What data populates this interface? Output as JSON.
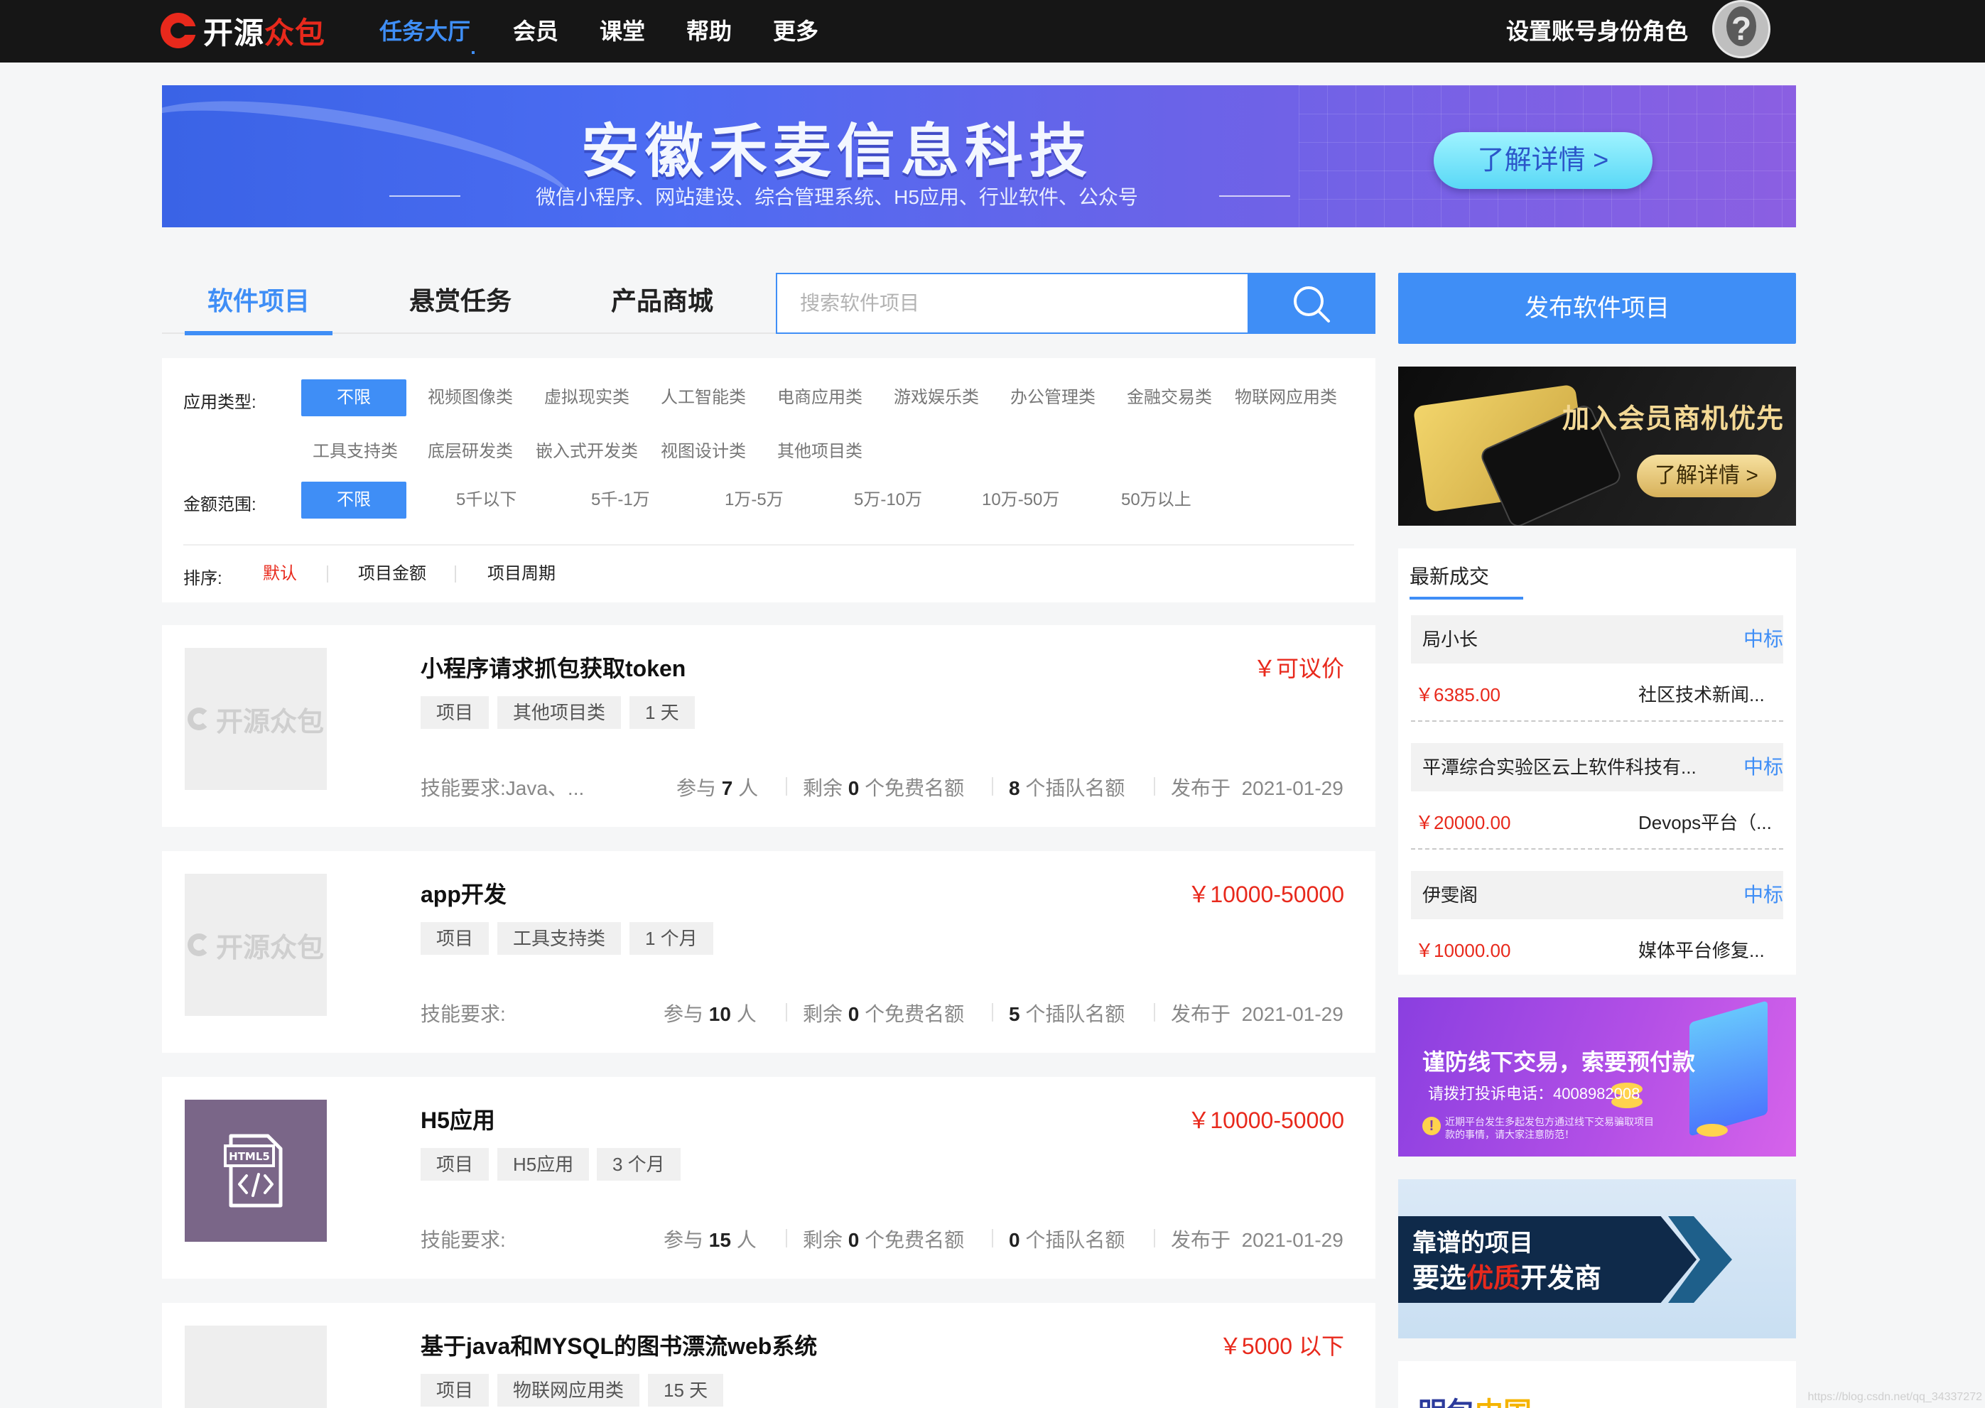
{
  "nav": {
    "logo_text_a": "开源",
    "logo_text_b": "众包",
    "items": [
      "任务大厅",
      "会员",
      "课堂",
      "帮助",
      "更多"
    ],
    "account_link": "设置账号身份角色",
    "avatar_glyph": "?"
  },
  "banner": {
    "title": "安徽禾麦信息科技",
    "subtitle": "微信小程序、网站建设、综合管理系统、H5应用、行业软件、公众号",
    "button": "了解详情 >"
  },
  "tabs": [
    "软件项目",
    "悬赏任务",
    "产品商城"
  ],
  "search": {
    "placeholder": "搜索软件项目"
  },
  "filters": {
    "type_label": "应用类型:",
    "type_options": [
      "不限",
      "视频图像类",
      "虚拟现实类",
      "人工智能类",
      "电商应用类",
      "游戏娱乐类",
      "办公管理类",
      "金融交易类",
      "物联网应用类",
      "工具支持类",
      "底层研发类",
      "嵌入式开发类",
      "视图设计类",
      "其他项目类"
    ],
    "amount_label": "金额范围:",
    "amount_options": [
      "不限",
      "5千以下",
      "5千-1万",
      "1万-5万",
      "5万-10万",
      "10万-50万",
      "50万以上"
    ],
    "sort_label": "排序:",
    "sort_options": [
      "默认",
      "项目金额",
      "项目周期"
    ]
  },
  "labels": {
    "skill": "技能要求:",
    "join_pre": "参与",
    "join_post": "人",
    "remain_pre": "剩余",
    "remain_post": "个免费名额",
    "queue_post": "个插队名额",
    "published": "发布于"
  },
  "thumb_logo": "开源众包",
  "projects": [
    {
      "title": "小程序请求抓包获取token",
      "price": "￥可议价",
      "tags": [
        "项目",
        "其他项目类",
        "1 天"
      ],
      "skills": "Java、...",
      "participants": "7",
      "free_left": "0",
      "queue": "8",
      "date": "2021-01-29",
      "thumb": "logo"
    },
    {
      "title": "app开发",
      "price": "￥10000-50000",
      "tags": [
        "项目",
        "工具支持类",
        "1 个月"
      ],
      "skills": "",
      "participants": "10",
      "free_left": "0",
      "queue": "5",
      "date": "2021-01-29",
      "thumb": "logo"
    },
    {
      "title": "H5应用",
      "price": "￥10000-50000",
      "tags": [
        "项目",
        "H5应用",
        "3 个月"
      ],
      "skills": "",
      "participants": "15",
      "free_left": "0",
      "queue": "0",
      "date": "2021-01-29",
      "thumb": "html5",
      "thumb_label": "HTML5"
    },
    {
      "title": "基于java和MYSQL的图书漂流web系统",
      "price": "￥5000 以下",
      "tags": [
        "项目",
        "物联网应用类",
        "15 天"
      ],
      "thumb": "logo"
    }
  ],
  "sidebar": {
    "publish_button": "发布软件项目",
    "vip_ad": {
      "title": "加入会员商机优先",
      "button": "了解详情 >"
    },
    "deals_title": "最新成交",
    "deals": [
      {
        "name": "局小长",
        "status": "中标",
        "amount": "￥6385.00",
        "project": "社区技术新闻..."
      },
      {
        "name": "平潭综合实验区云上软件科技有...",
        "status": "中标",
        "amount": "￥20000.00",
        "project": "Devops平台（..."
      },
      {
        "name": "伊雯阁",
        "status": "中标",
        "amount": "￥10000.00",
        "project": "媒体平台修复..."
      }
    ],
    "warn_ad": {
      "title": "谨防线下交易，索要预付款",
      "phone": "请拨打投诉电话：4008982008",
      "notice": "近期平台发生多起发包方通过线下交易骗取项目款的事情，请大家注意防范！"
    },
    "dev_ad": {
      "line1": "靠谱的项目",
      "line2_a": "要选",
      "line2_hl": "优质",
      "line2_b": "开发商"
    },
    "next_ad": {
      "a": "明包",
      "b": "中国"
    }
  },
  "watermark": "https://blog.csdn.net/qq_34337272",
  "colors": {
    "accent": "#3f8ef6",
    "price": "#e8291c",
    "nav_bg": "#161616"
  }
}
